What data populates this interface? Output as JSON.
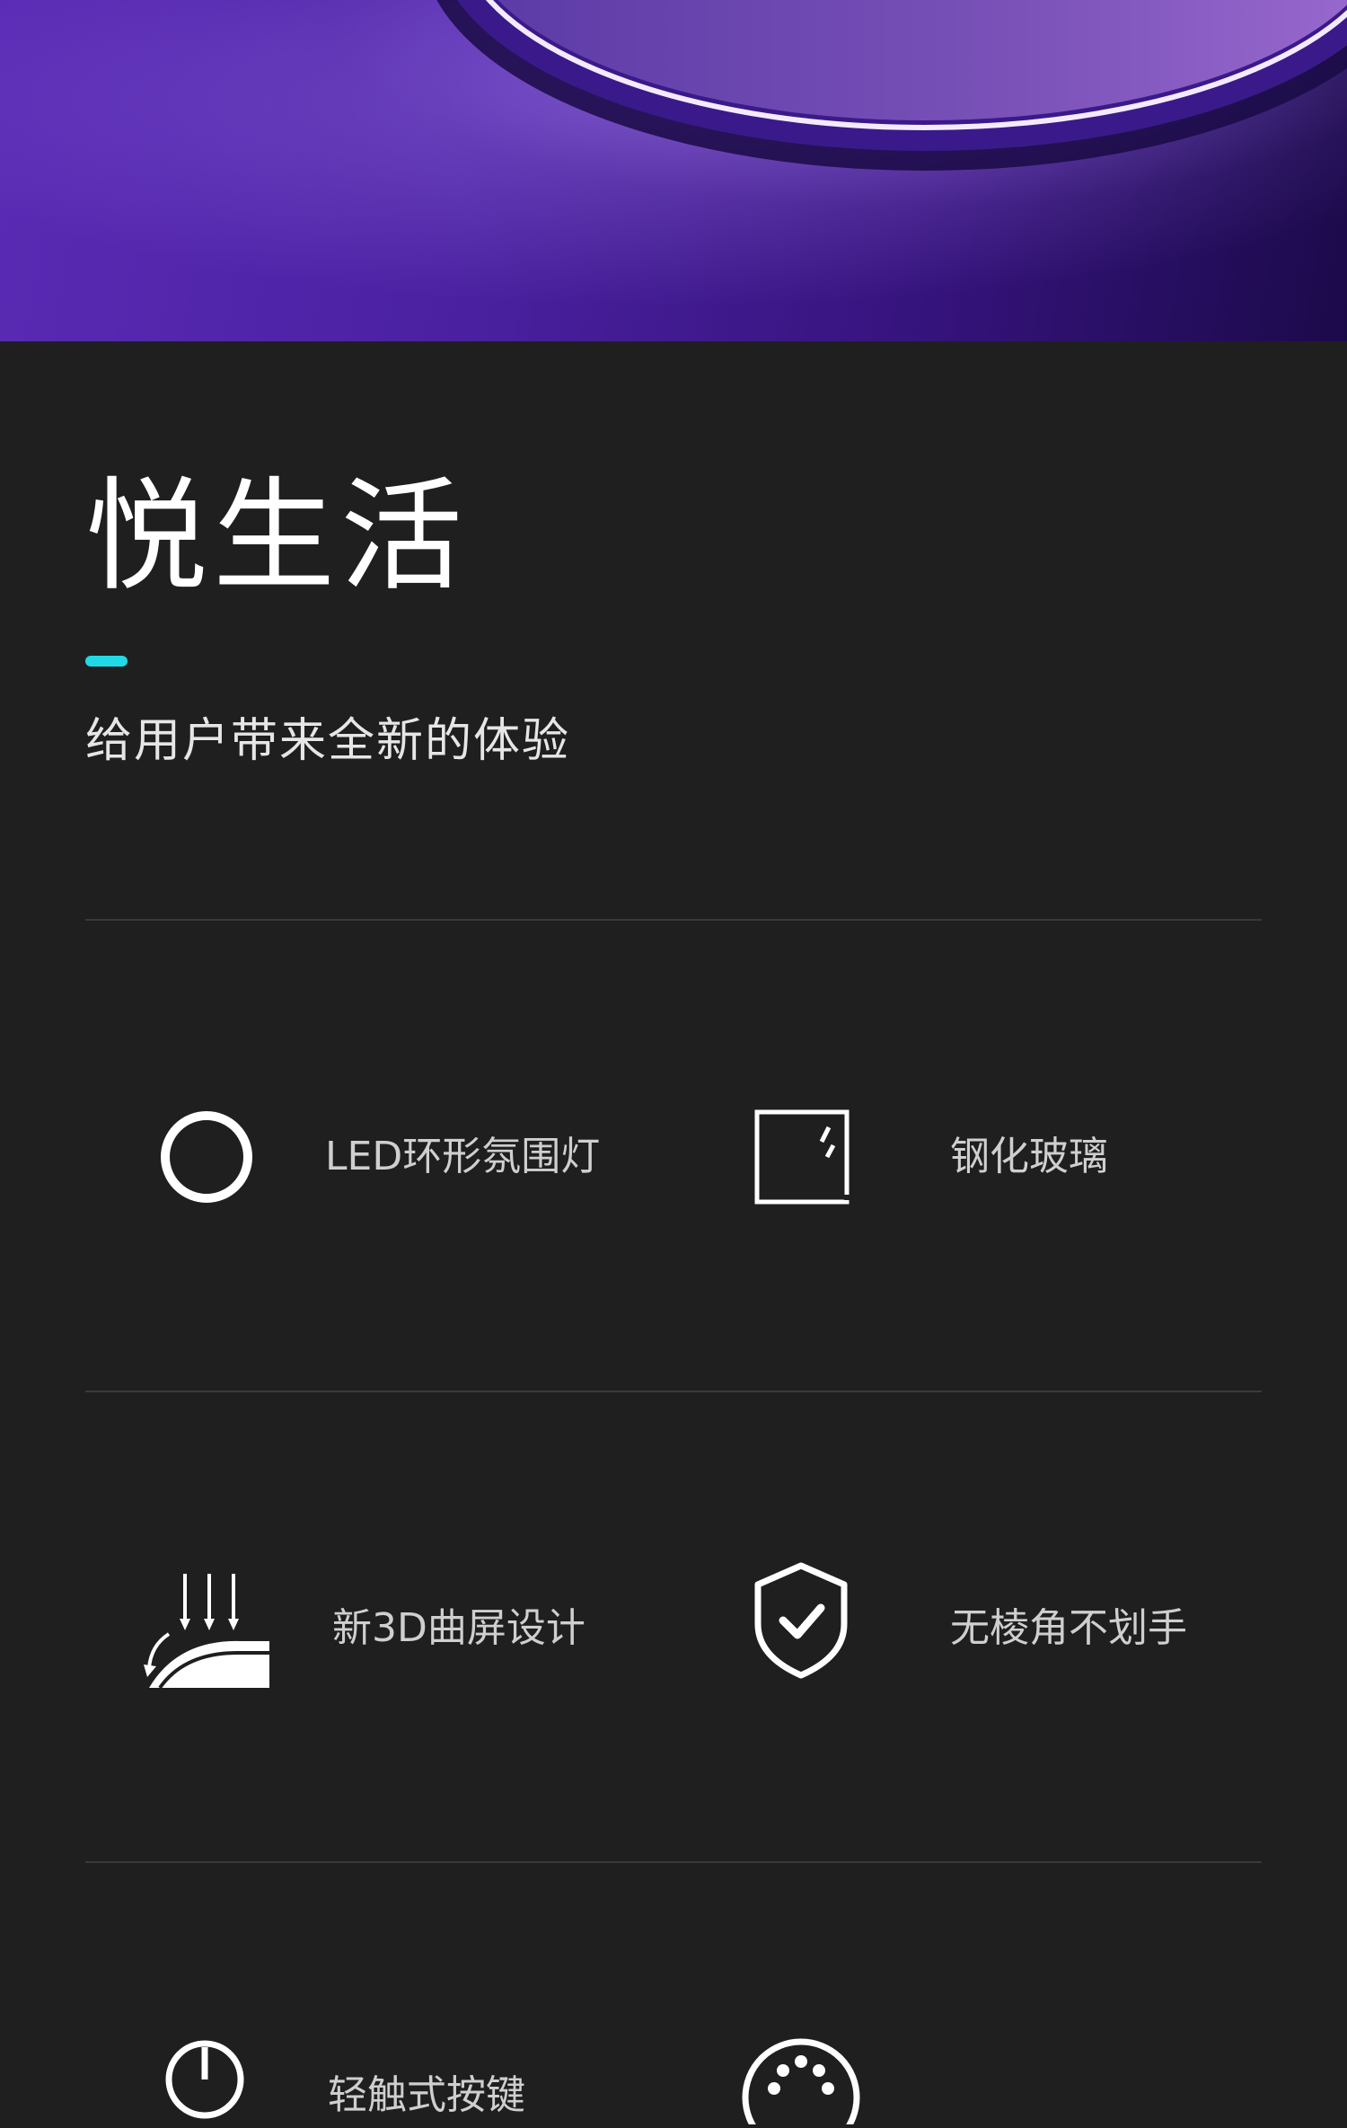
{
  "heading": {
    "title": "悦生活",
    "subtitle": "给用户带来全新的体验"
  },
  "colors": {
    "background": "#1f1f1f",
    "accent": "#22d8e6",
    "hero_purple": "#4b21a2",
    "label": "#cfcfcf"
  },
  "features": [
    {
      "label": "LED环形氛围灯",
      "icon": "ring-light-icon"
    },
    {
      "label": "钢化玻璃",
      "icon": "glass-panel-icon"
    },
    {
      "label": "新3D曲屏设计",
      "icon": "curved-screen-icon"
    },
    {
      "label": "无棱角不划手",
      "icon": "shield-check-icon"
    },
    {
      "label": "轻触式按键",
      "icon": "power-button-icon"
    },
    {
      "label": "",
      "icon": "dots-dial-icon"
    }
  ]
}
